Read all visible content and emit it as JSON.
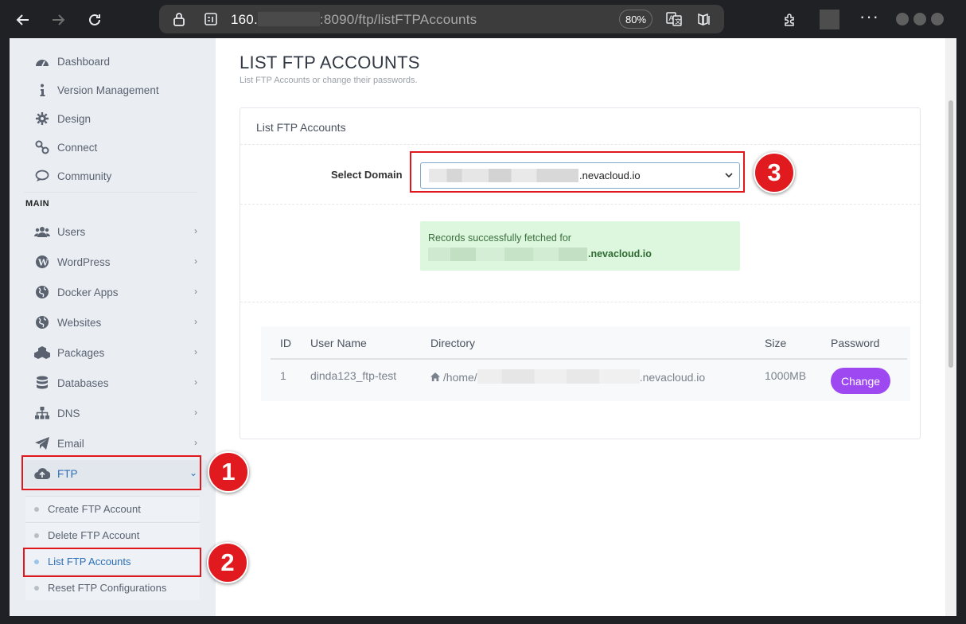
{
  "browser": {
    "url_host": "160.",
    "url_rest": ":8090",
    "url_path": "/ftp/listFTPAccounts",
    "zoom": "80%",
    "more_label": "···"
  },
  "sidebar": {
    "top_items": [
      {
        "label": "Dashboard",
        "icon": "dashboard-icon"
      },
      {
        "label": "Version Management",
        "icon": "info-icon"
      },
      {
        "label": "Design",
        "icon": "gear-icon"
      },
      {
        "label": "Connect",
        "icon": "link-icon"
      },
      {
        "label": "Community",
        "icon": "chat-icon"
      }
    ],
    "section_label": "MAIN",
    "main_items": [
      {
        "label": "Users",
        "icon": "users-icon"
      },
      {
        "label": "WordPress",
        "icon": "wordpress-icon"
      },
      {
        "label": "Docker Apps",
        "icon": "globe-icon"
      },
      {
        "label": "Websites",
        "icon": "globe-icon"
      },
      {
        "label": "Packages",
        "icon": "packages-icon"
      },
      {
        "label": "Databases",
        "icon": "database-icon"
      },
      {
        "label": "DNS",
        "icon": "sitemap-icon"
      },
      {
        "label": "Email",
        "icon": "paper-plane-icon"
      },
      {
        "label": "FTP",
        "icon": "cloud-upload-icon"
      }
    ],
    "ftp_submenu": [
      {
        "label": "Create FTP Account"
      },
      {
        "label": "Delete FTP Account"
      },
      {
        "label": "List FTP Accounts"
      },
      {
        "label": "Reset FTP Configurations"
      }
    ]
  },
  "main": {
    "title": "LIST FTP ACCOUNTS",
    "subtitle": "List FTP Accounts or change their passwords.",
    "panel_title": "List FTP Accounts",
    "select_domain_label": "Select Domain",
    "select_domain_value": ".nevacloud.io",
    "alert_line1": "Records successfully fetched for",
    "alert_line2": ".nevacloud.io",
    "table": {
      "headers": [
        "ID",
        "User Name",
        "Directory",
        "Size",
        "Password"
      ],
      "rows": [
        {
          "id": "1",
          "username": "dinda123_ftp-test",
          "dir_prefix": "/home/",
          "dir_suffix": ".nevacloud.io",
          "size": "1000MB",
          "action": "Change"
        }
      ]
    }
  },
  "annotations": [
    "1",
    "2",
    "3"
  ],
  "colors": {
    "annotation_red": "#e0171d",
    "change_button": "#9d48f0",
    "active_link": "#2c6fb8",
    "success_bg": "#dcf7dd"
  }
}
